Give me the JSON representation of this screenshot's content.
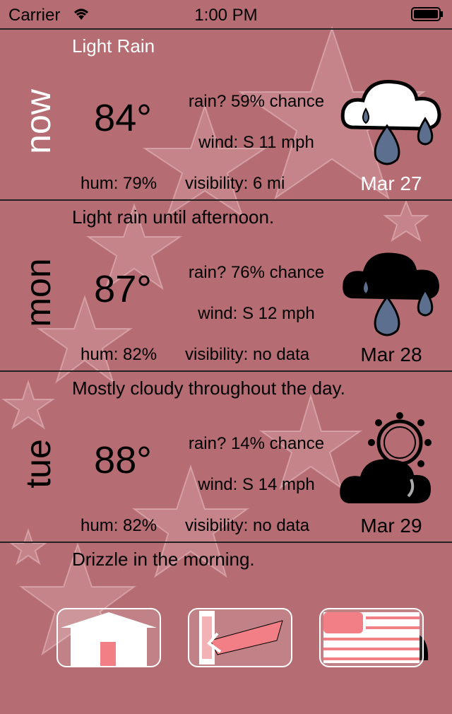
{
  "status_bar": {
    "carrier": "Carrier",
    "time": "1:00 PM"
  },
  "forecasts": [
    {
      "day": "now",
      "summary": "Light Rain",
      "temp": "84°",
      "rain": "rain? 59% chance",
      "wind": "wind: S 11 mph",
      "humidity": "hum: 79%",
      "visibility": "visibility: 6 mi",
      "date": "Mar 27",
      "icon": "rain-cloud-icon"
    },
    {
      "day": "mon",
      "summary": "Light rain until afternoon.",
      "temp": "87°",
      "rain": "rain? 76% chance",
      "wind": "wind: S 12 mph",
      "humidity": "hum: 82%",
      "visibility": "visibility: no data",
      "date": "Mar 28",
      "icon": "rain-cloud-icon"
    },
    {
      "day": "tue",
      "summary": "Mostly cloudy throughout the day.",
      "temp": "88°",
      "rain": "rain? 14% chance",
      "wind": "wind: S 14 mph",
      "humidity": "hum: 82%",
      "visibility": "visibility: no data",
      "date": "Mar 29",
      "icon": "partly-cloudy-icon"
    },
    {
      "day": "",
      "summary": "Drizzle in the morning.",
      "icon": "cloud-icon"
    }
  ],
  "toolbar": {
    "buttons": [
      "home-button",
      "back-button",
      "list-button"
    ]
  },
  "colors": {
    "background": "#b56c72",
    "accent": "#f27f85",
    "rain_drop": "#5d6f8f"
  }
}
